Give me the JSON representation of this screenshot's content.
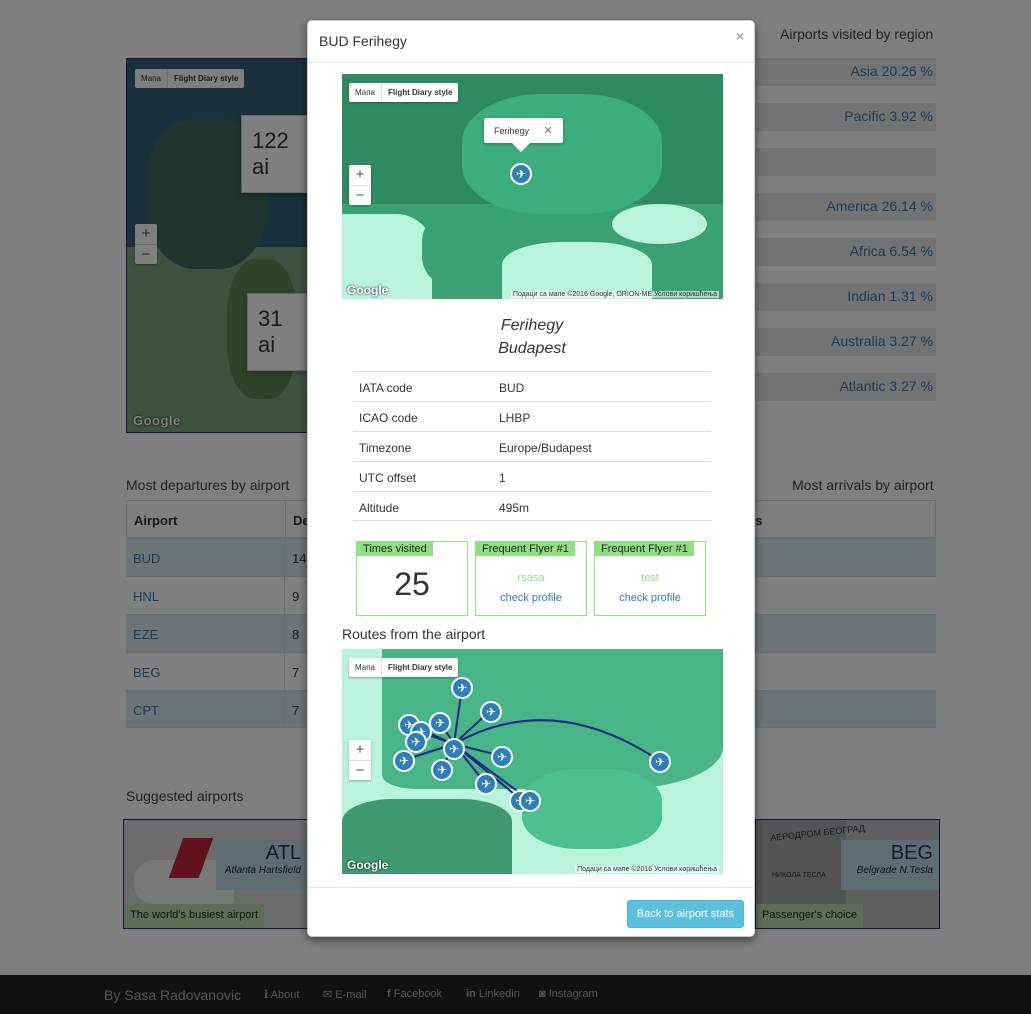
{
  "background": {
    "region_title": "Airports visited by region",
    "regions": [
      {
        "name": "Asia",
        "pct": "20.26 %"
      },
      {
        "name": "Pacific",
        "pct": "3.92 %"
      },
      {
        "name": "",
        "pct": ""
      },
      {
        "name": "America",
        "pct": "26.14 %"
      },
      {
        "name": "Africa",
        "pct": "6.54 %"
      },
      {
        "name": "Indian",
        "pct": "1.31 %"
      },
      {
        "name": "Australia",
        "pct": "3.27 %"
      },
      {
        "name": "Atlantic",
        "pct": "3.27 %"
      }
    ],
    "world_map": {
      "btn_map": "Мапа",
      "btn_style": "Flight Diary style",
      "callout1": "122 ai",
      "callout2": "31 ai",
      "zoom_in": "+",
      "zoom_out": "−",
      "google": "Google"
    },
    "departures_title": "Most departures by airport",
    "arrivals_title": "Most arrivals by airport",
    "departures_header": {
      "airport": "Airport",
      "departures": "De",
      "arrivals": "res"
    },
    "departures_rows": [
      {
        "airport": "BUD",
        "count": "14"
      },
      {
        "airport": "HNL",
        "count": "9"
      },
      {
        "airport": "EZE",
        "count": "8"
      },
      {
        "airport": "BEG",
        "count": "7"
      },
      {
        "airport": "CPT",
        "count": "7"
      }
    ],
    "suggested_title": "Suggested airports",
    "suggested": [
      {
        "code": "ATL",
        "city": "Atlanta Hartsfield",
        "tag": "The world's busiest airport"
      },
      {
        "code": "BEG",
        "city": "Belgrade N.Tesla",
        "tag": "Passenger's choice",
        "sign": "АЕРОДРОМ БЕОГРАД",
        "sign2": "НИКОЛА ТЕСЛА"
      }
    ],
    "footer": {
      "name": "By Sasa Radovanovic",
      "links": [
        "About",
        "E-mail",
        "Facebook",
        "Linkedin",
        "Instagram"
      ]
    }
  },
  "modal": {
    "title": "BUD Ferihegy",
    "close": "×",
    "map1": {
      "btn_map": "Мапа",
      "btn_style": "Flight Diary style",
      "info_label": "Ferihegy",
      "info_close": "✕",
      "zoom_in": "+",
      "zoom_out": "−",
      "google": "Google",
      "attribution": "Подаци са мапе ©2016 Google, ORION-ME  Услови коришћења"
    },
    "airport_name": "Ferihegy",
    "city": "Budapest",
    "info": [
      {
        "key": "IATA code",
        "value": "BUD"
      },
      {
        "key": "ICAO code",
        "value": "LHBP"
      },
      {
        "key": "Timezone",
        "value": "Europe/Budapest"
      },
      {
        "key": "UTC offset",
        "value": "1"
      },
      {
        "key": "Altitude",
        "value": "495m"
      }
    ],
    "times_visited_label": "Times visited",
    "times_visited": "25",
    "frequent1": {
      "label": "Frequent Flyer #1",
      "user": "rsasa",
      "link": "check profile"
    },
    "frequent2": {
      "label": "Frequent Flyer #1",
      "user": "test",
      "link": "check profile"
    },
    "routes_title": "Routes from the airport",
    "map2": {
      "btn_map": "Мапа",
      "btn_style": "Flight Diary style",
      "zoom_in": "+",
      "zoom_out": "−",
      "google": "Google",
      "attribution": "Подаци са мапе ©2016  Услови коришћења"
    },
    "back_button": "Back to airport stats",
    "colors": {
      "accent_green": "#8fe07f",
      "button_info": "#5bc0de",
      "link": "#337ab7"
    }
  }
}
